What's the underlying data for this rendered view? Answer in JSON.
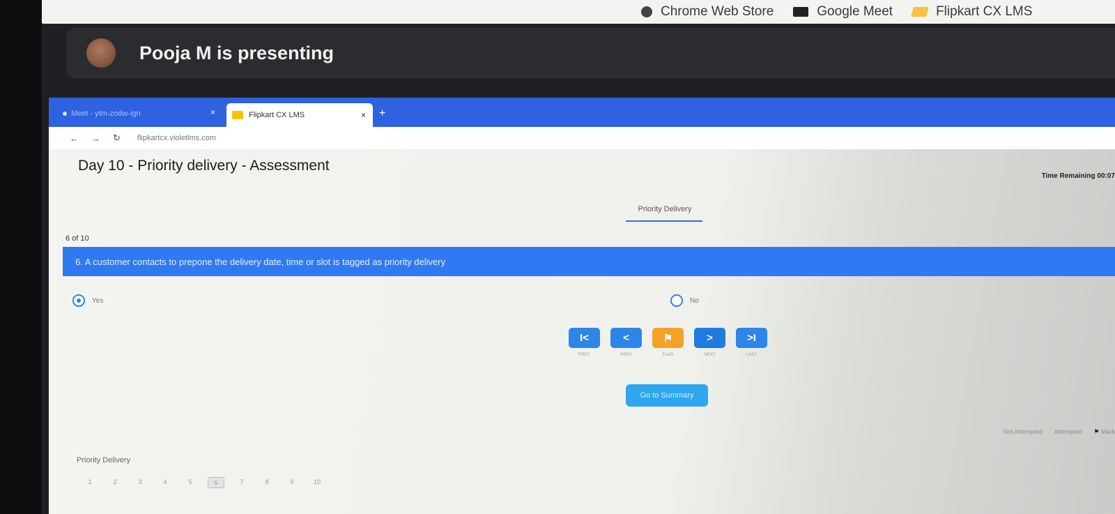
{
  "bookmarks": [
    {
      "label": "Chrome Web Store",
      "icon": "store-icon"
    },
    {
      "label": "Google Meet",
      "icon": "meet-icon"
    },
    {
      "label": "Flipkart CX LMS",
      "icon": "flipkart-icon"
    }
  ],
  "meet": {
    "presenter_text": "Pooja M is presenting"
  },
  "shared_browser": {
    "tabs": [
      {
        "label": "Meet - ytm-zodw-ign"
      },
      {
        "label": "Flipkart CX LMS"
      }
    ],
    "url": "flipkartcx.violetlms.com"
  },
  "assessment": {
    "title": "Day 10 - Priority delivery - Assessment",
    "timer": "Time Remaining 00:07",
    "category_tab": "Priority Delivery",
    "counter": "6 of 10",
    "question": "6. A customer contacts to prepone the delivery date, time or slot is tagged as priority delivery",
    "options": [
      {
        "label": "Yes",
        "selected": true
      },
      {
        "label": "No",
        "selected": false
      }
    ],
    "nav_buttons": [
      {
        "symbol": "I<",
        "label": "FIRST"
      },
      {
        "symbol": "<",
        "label": "PREV"
      },
      {
        "symbol": "⚑",
        "label": "FLAG"
      },
      {
        "symbol": ">",
        "label": "NEXT"
      },
      {
        "symbol": ">I",
        "label": "LAST"
      }
    ],
    "summary_button": "Go to Summary",
    "legend": {
      "not_attempted": "Not Attempted",
      "attempted": "Attempted",
      "marked": "Mark"
    },
    "section_label": "Priority Delivery",
    "question_numbers": [
      "1",
      "2",
      "3",
      "4",
      "5",
      "6",
      "7",
      "8",
      "9",
      "10"
    ],
    "current_question": "6"
  },
  "colors": {
    "tabstrip": "#2f62e0",
    "question_bar": "#2f7af2",
    "flag_button": "#f3a228",
    "summary_button": "#2fa6f0"
  }
}
